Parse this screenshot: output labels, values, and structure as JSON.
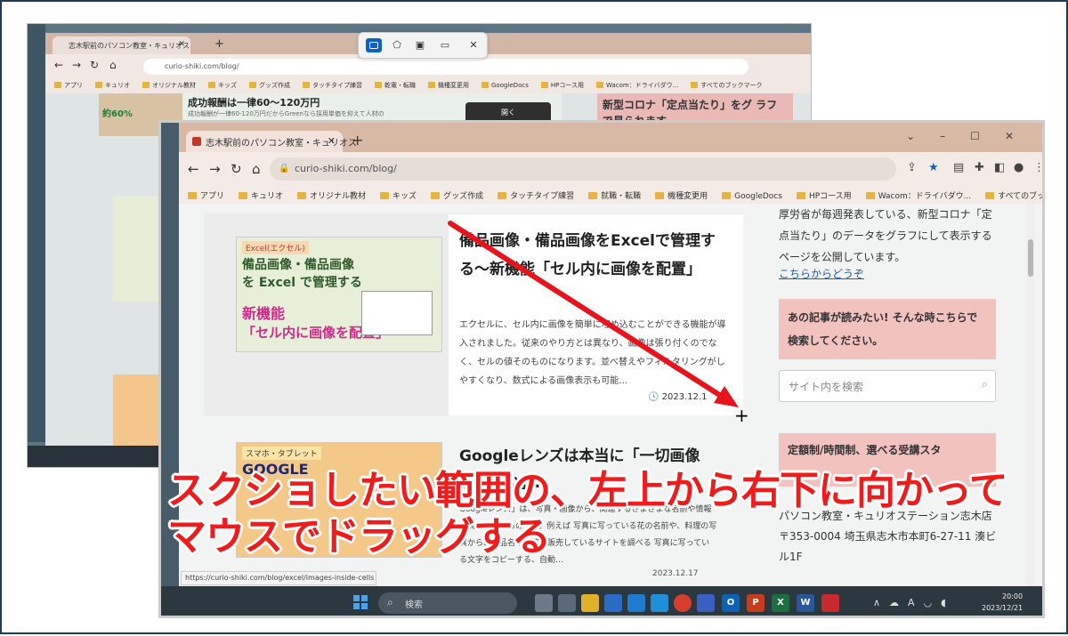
{
  "back": {
    "tab_title": "志木駅前のパソコン教室・キュリオス",
    "url": "curio-shiki.com/blog/",
    "bookmarks": [
      "アプリ",
      "キュリオ",
      "オリジナル教材",
      "キッズ",
      "グッズ作成",
      "タッチタイプ練習",
      "乾電・転職",
      "機種変更用",
      "GoogleDocs",
      "HPコース用",
      "Wacom：ドライバダウ...",
      "すべてのブックマーク"
    ],
    "ad_title": "成功報酬は一律60～120万円",
    "ad_sub": "成功報酬が一律60-120万円だからGreenなら採用単価を抑えて人材の",
    "ad_pct": "約60%",
    "ad_button": "開く",
    "side_heading": "新型コロナ「定点当たり」をグ ラフで見られます"
  },
  "crop_toolbar": {
    "close": "✕"
  },
  "front": {
    "tab_title": "志木駅前のパソコン教室・キュリオス",
    "url": "curio-shiki.com/blog/",
    "bookmarks": [
      "アプリ",
      "キュリオ",
      "オリジナル教材",
      "キッズ",
      "グッズ作成",
      "タッチタイプ練習",
      "就職・転職",
      "機種変更用",
      "GoogleDocs",
      "HPコース用",
      "Wacom：ドライバダウ...",
      "すべてのブックマーク"
    ],
    "article1": {
      "thumb_label": "Excel(エクセル)",
      "thumb_line1": "備品画像・備品画像",
      "thumb_line2": "を Excel で管理する",
      "thumb_line3": "新機能",
      "thumb_line4": "「セル内に画像を配置」",
      "title": "備品画像・備品画像をExcelで管理する～新機能「セル内に画像を配置」",
      "desc": "エクセルに、セル内に画像を簡単に埋め込むことができる機能が導入されました。従来のやり方とは異なり、画像は張り付くのでなく、セルの値そのものになります。並べ替えやフィルタリングがしやすくなり、数式による画像表示も可能…",
      "date": "2023.12.1"
    },
    "article2": {
      "thumb_label": "スマホ・タブレット",
      "thumb_line1": "GOOGLE",
      "title": "Googleレンズは本当に「一切画像を…ない」…",
      "desc": "Googleレンズ」は、写真・画像から、関連するさまざまな名前や情報を調べられるものです。例えば 写真に写っている花の名前や、料理の写真から、商品名や価格、販売しているサイトを調べる 写真に写っている文字をコピーする、自動…",
      "date": "2023.12.17"
    },
    "sidebar": {
      "text": "厚労省が毎週発表している、新型コロナ「定点当たり」のデータをグラフにして表示するページを公開しています。",
      "link": "こちらからどうぞ",
      "box1": "あの記事が読みたい! そんな時こちらで検索してください。",
      "search_placeholder": "サイト内を検索",
      "box2": "定額制/時間制、選べる受講スタ",
      "address": "パソコン教室・キュリオステーション志木店 〒353-0004 埼玉県志木市本町6-27-11 湊ビル1F"
    },
    "status_url": "https://curio-shiki.com/blog/excel/images-inside-cells",
    "taskbar": {
      "search": "検索",
      "time": "20:00",
      "date": "2023/12/21"
    }
  },
  "caption": {
    "line1": "スクショしたい範囲の、左上から右下に向かって",
    "line2": "マウスでドラッグする"
  },
  "colors": {
    "caption": "#f21b1b",
    "arrow": "#e8141b",
    "accent": "#0a62c2"
  }
}
